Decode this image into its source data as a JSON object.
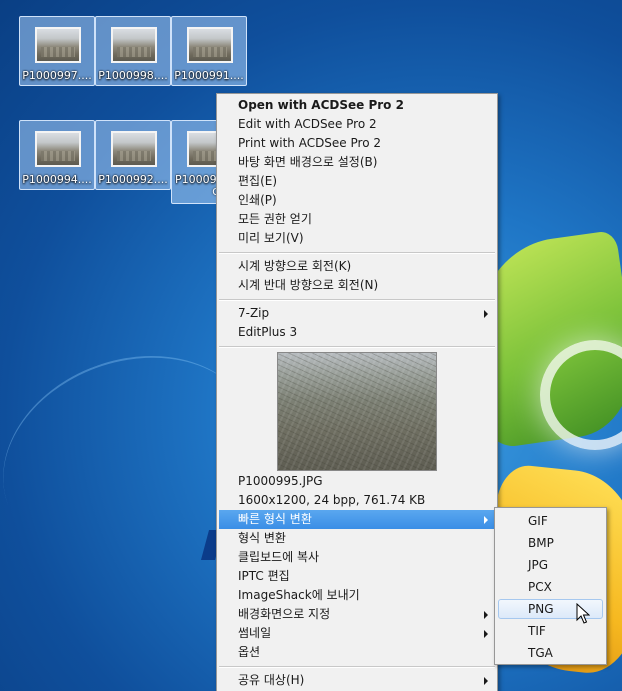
{
  "desktop": {
    "icons_row1": [
      {
        "label": "P1000997...."
      },
      {
        "label": "P1000998...."
      },
      {
        "label": "P1000991...."
      }
    ],
    "icons_row2": [
      {
        "label": "P1000994...."
      },
      {
        "label": "P1000992...."
      },
      {
        "label": "P10009",
        "sub": "G"
      }
    ]
  },
  "context_menu": {
    "open_with": "Open with ACDSee Pro 2",
    "edit_with": "Edit with ACDSee Pro 2",
    "print_with": "Print with ACDSee Pro 2",
    "set_wallpaper": "바탕 화면 배경으로 설정(B)",
    "edit": "편집(E)",
    "print": "인쇄(P)",
    "take_ownership": "모든 권한 얻기",
    "preview": "미리 보기(V)",
    "rotate_cw": "시계 방향으로 회전(K)",
    "rotate_ccw": "시계 반대 방향으로 회전(N)",
    "seven_zip": "7-Zip",
    "editplus": "EditPlus 3",
    "file_name": "P1000995.JPG",
    "file_info": "1600x1200, 24 bpp, 761.74 KB",
    "quick_convert": "빠른 형식 변환",
    "convert": "형식 변환",
    "copy_clipboard": "클립보드에 복사",
    "iptc_edit": "IPTC 편집",
    "imageshack": "ImageShack에 보내기",
    "set_background": "배경화면으로 지정",
    "thumbnail": "썸네일",
    "options": "옵션",
    "share_with": "공유 대상(H)"
  },
  "submenu": {
    "items": [
      "GIF",
      "BMP",
      "JPG",
      "PCX",
      "PNG",
      "TIF",
      "TGA"
    ],
    "hovered": "PNG"
  }
}
